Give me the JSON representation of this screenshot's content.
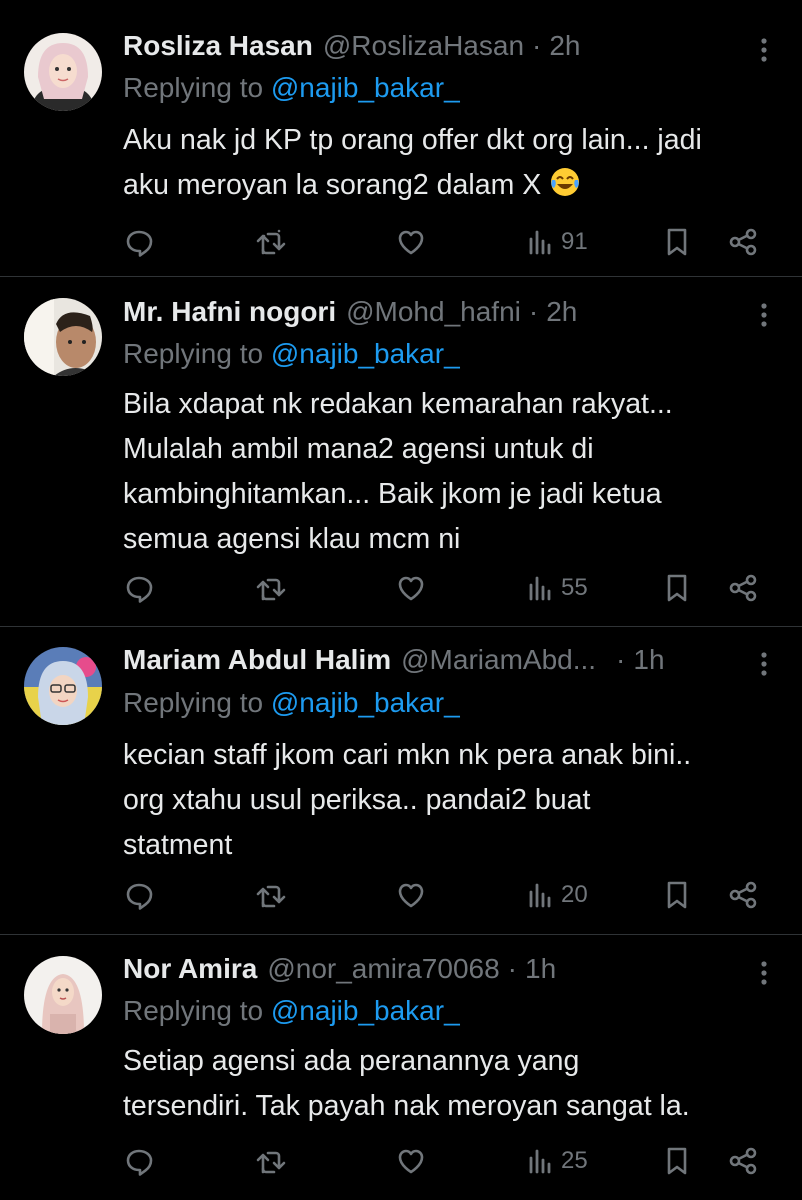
{
  "tweets": [
    {
      "name": "Rosliza Hasan",
      "handle": "@RoslizaHasan",
      "time": "2h",
      "reply_prefix": "Replying to ",
      "reply_to": "@najib_bakar_",
      "lines": [
        "Aku nak jd KP tp orang offer dkt org lain... jadi",
        "aku meroyan la sorang2 dalam X"
      ],
      "emoji": "face-with-tears-of-joy",
      "views": "91"
    },
    {
      "name": "Mr. Hafni nogori",
      "handle": "@Mohd_hafni",
      "time": "2h",
      "reply_prefix": "Replying to ",
      "reply_to": "@najib_bakar_",
      "lines": [
        "Bila xdapat nk redakan kemarahan rakyat...",
        "Mulalah ambil mana2 agensi untuk di",
        "kambinghitamkan... Baik jkom je jadi ketua",
        "semua agensi klau mcm ni"
      ],
      "views": "55"
    },
    {
      "name": "Mariam Abdul Halim",
      "handle": "@MariamAbd...",
      "time": "1h",
      "reply_prefix": "Replying to ",
      "reply_to": "@najib_bakar_",
      "lines": [
        "kecian staff jkom cari mkn nk pera anak bini..",
        "org xtahu usul periksa.. pandai2 buat",
        "statment"
      ],
      "views": "20"
    },
    {
      "name": "Nor Amira",
      "handle": "@nor_amira70068",
      "time": "1h",
      "reply_prefix": "Replying to ",
      "reply_to": "@najib_bakar_",
      "lines": [
        "Setiap agensi ada peranannya yang",
        "tersendiri. Tak payah nak meroyan sangat la."
      ],
      "views": "25"
    }
  ],
  "icons": {
    "reply": "reply-icon",
    "retweet": "retweet-icon",
    "like": "like-icon",
    "views": "views-icon",
    "bookmark": "bookmark-icon",
    "share": "share-icon",
    "more": "more-icon"
  },
  "colors": {
    "background": "#000000",
    "text": "#e7e9ea",
    "muted": "#71767b",
    "link": "#1d9bf0",
    "divider": "#2f3336"
  }
}
